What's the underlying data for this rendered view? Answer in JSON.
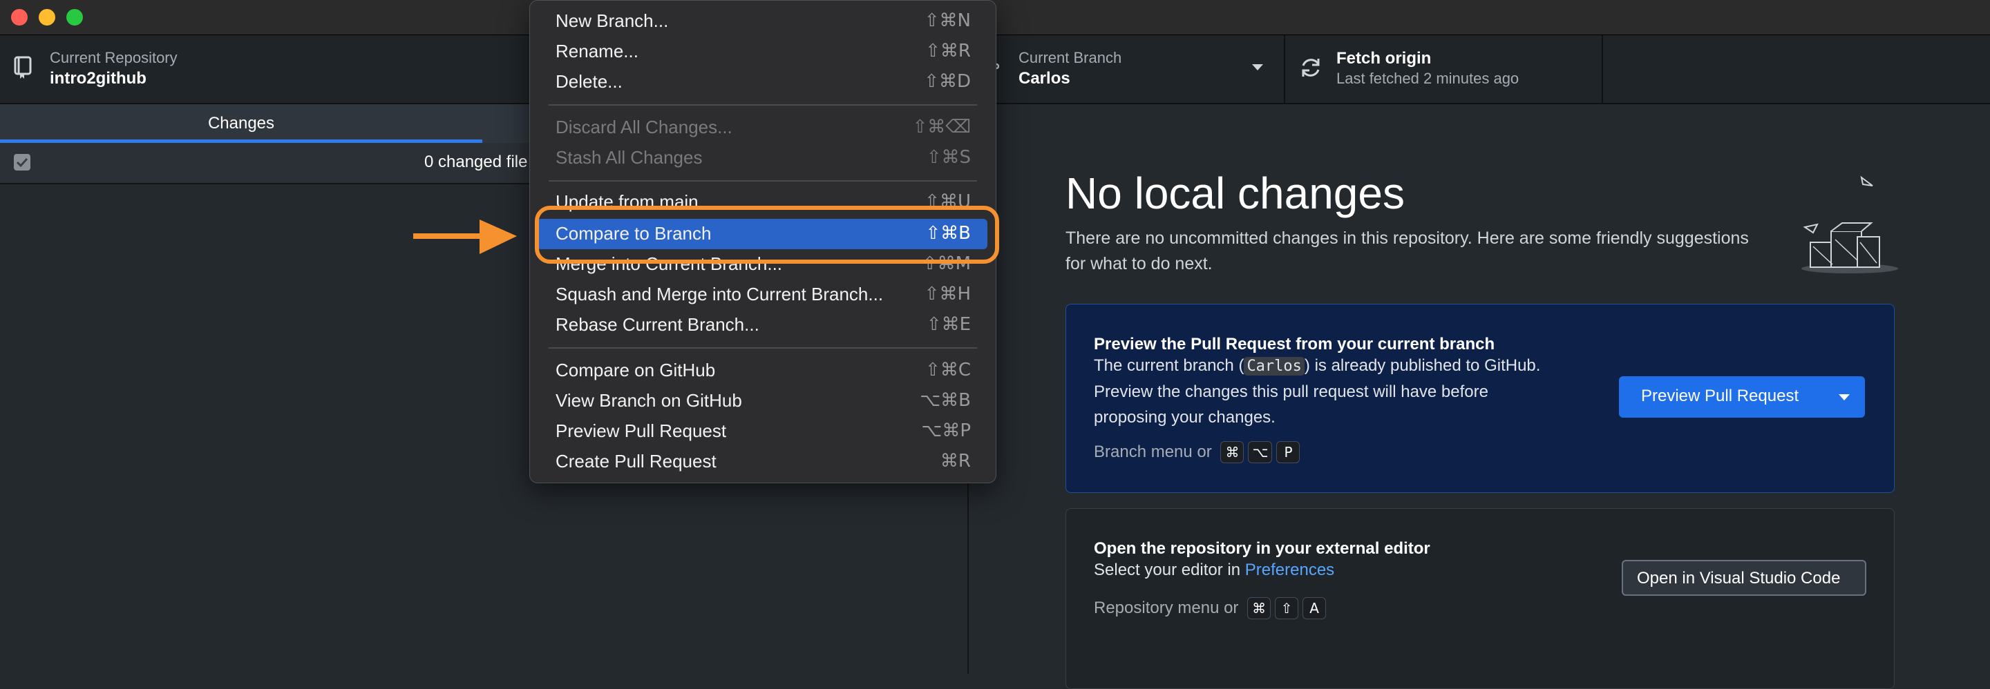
{
  "toolbar": {
    "repository": {
      "label": "Current Repository",
      "value": "intro2github"
    },
    "branch": {
      "label": "Current Branch",
      "value": "Carlos"
    },
    "fetch": {
      "title": "Fetch origin",
      "subtitle": "Last fetched 2 minutes ago"
    }
  },
  "left_pane": {
    "tabs": [
      {
        "label": "Changes"
      }
    ],
    "changed_files": "0 changed file"
  },
  "main": {
    "heading": "No local changes",
    "description": "There are no uncommitted changes in this repository. Here are some friendly suggestions for what to do next.",
    "pull_request_card": {
      "title": "Preview the Pull Request from your current branch",
      "text_before": "The current branch (",
      "branch_code": "Carlos",
      "text_after": ") is already published to GitHub.",
      "line2": "Preview the changes this pull request will have before",
      "line3": "proposing your changes.",
      "hint": "Branch menu or",
      "keys": [
        "⌘",
        "⌥",
        "P"
      ],
      "button": "Preview Pull Request"
    },
    "editor_card": {
      "title": "Open the repository in your external editor",
      "text": "Select your editor in",
      "link": "Preferences",
      "hint": "Repository menu or",
      "keys": [
        "⌘",
        "⇧",
        "A"
      ],
      "button": "Open in Visual Studio Code"
    }
  },
  "menu": {
    "items": [
      {
        "label": "New Branch...",
        "shortcut": "⇧⌘N"
      },
      {
        "label": "Rename...",
        "shortcut": "⇧⌘R"
      },
      {
        "label": "Delete...",
        "shortcut": "⇧⌘D"
      },
      {
        "label": "Discard All Changes...",
        "shortcut": "⇧⌘⌫"
      },
      {
        "label": "Stash All Changes",
        "shortcut": "⇧⌘S"
      },
      {
        "label": "Update from main",
        "shortcut": "⇧⌘U"
      },
      {
        "label": "Compare to Branch",
        "shortcut": "⇧⌘B"
      },
      {
        "label": "Merge into Current Branch...",
        "shortcut": "⇧⌘M"
      },
      {
        "label": "Squash and Merge into Current Branch...",
        "shortcut": "⇧⌘H"
      },
      {
        "label": "Rebase Current Branch...",
        "shortcut": "⇧⌘E"
      },
      {
        "label": "Compare on GitHub",
        "shortcut": "⇧⌘C"
      },
      {
        "label": "View Branch on GitHub",
        "shortcut": "⌥⌘B"
      },
      {
        "label": "Preview Pull Request",
        "shortcut": "⌥⌘P"
      },
      {
        "label": "Create Pull Request",
        "shortcut": "⌘R"
      }
    ]
  },
  "colors": {
    "accent": "#2f7bea",
    "highlight": "#2a64c8",
    "callout": "#f5922f",
    "card_blue": "#0d2148"
  }
}
